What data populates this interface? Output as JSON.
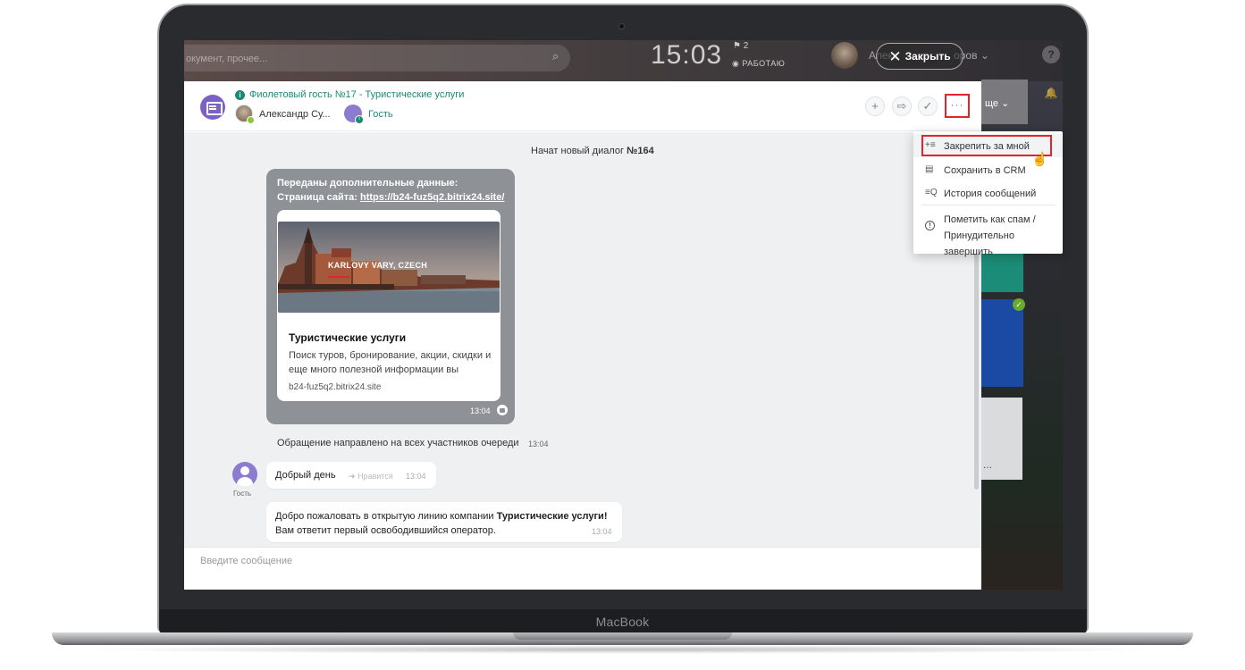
{
  "device": {
    "brand": "MacBook"
  },
  "topbar": {
    "search_placeholder": "окумент, прочее...",
    "time": "15:03",
    "flag_count": "2",
    "work_status": "РАБОТАЮ",
    "user_name_left": "Алекс",
    "user_name_right": "оров",
    "close_label": "Закрыть"
  },
  "background": {
    "tile_label": "ще",
    "tile_dots": "..."
  },
  "chat": {
    "title": "Фиолетовый гость №17 - Туристические услуги",
    "members": [
      {
        "name": "Александр Су..."
      },
      {
        "name": "Гость"
      }
    ],
    "header_buttons": [
      "+",
      "⇨",
      "✓",
      "···"
    ],
    "system_title_prefix": "Начат новый диалог ",
    "system_title_number": "№164",
    "data_message": {
      "line1": "Переданы дополнительные данные:",
      "line2_label": "Страница сайта: ",
      "line2_link": "https://b24-fuz5q2.bitrix24.site/",
      "card_image_caption": "KARLOVY VARY, CZECH",
      "card_title": "Туристические услуги",
      "card_desc": "Поиск туров, бронирование, акции, скидки и еще много полезной информации вы",
      "card_domain": "b24-fuz5q2.bitrix24.site",
      "time": "13:04"
    },
    "notice": {
      "text": "Обращение направлено на всех участников очереди",
      "time": "13:04"
    },
    "guest_label": "Гость",
    "message1": {
      "text": "Добрый день",
      "like": "Нравится",
      "time": "13:04"
    },
    "message2": {
      "text_prefix": "Добро пожаловать в открытую линию компании ",
      "text_bold": "Туристические услуги!",
      "text_line2": "Вам ответит первый освободившийся оператор.",
      "time": "13:04"
    },
    "input_placeholder": "Введите сообщение"
  },
  "menu": {
    "items": [
      {
        "icon": "+≡",
        "label": "Закрепить за мной"
      },
      {
        "icon": "▤",
        "label": "Сохранить в CRM"
      },
      {
        "icon": "≡Q",
        "label": "История сообщений"
      },
      {
        "icon": "!",
        "label_line1": "Пометить как спам /",
        "label_line2": "Принудительно завершить"
      }
    ]
  },
  "colors": {
    "accent_green": "#1b8a74",
    "highlight_red": "#e0262b",
    "guest_purple": "#8d7bd0"
  }
}
